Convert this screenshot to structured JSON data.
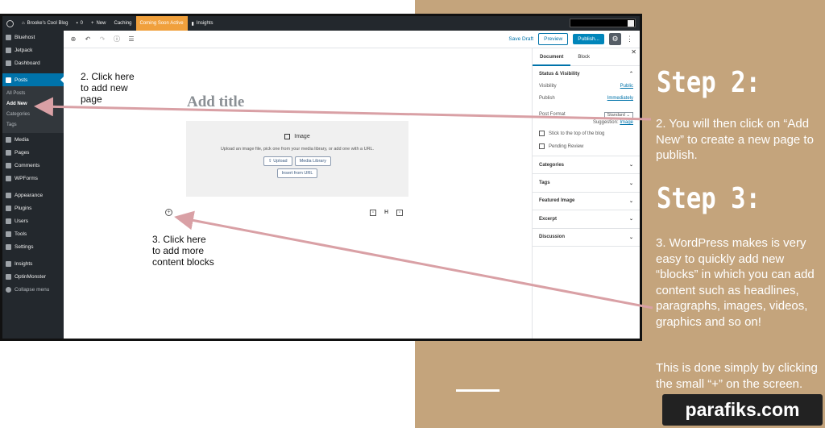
{
  "admin_bar": {
    "site": "Brooke's Cool Blog",
    "comments": "0",
    "new": "New",
    "caching": "Caching",
    "coming_soon": "Coming Soon Active",
    "insights": "Insights"
  },
  "sidebar": {
    "items_top": [
      {
        "label": "Bluehost",
        "icon": "bluehost-icon"
      },
      {
        "label": "Jetpack",
        "icon": "jetpack-icon"
      },
      {
        "label": "Dashboard",
        "icon": "dashboard-icon"
      }
    ],
    "posts": "Posts",
    "sub": [
      "All Posts",
      "Add New",
      "Categories",
      "Tags"
    ],
    "items_mid": [
      {
        "label": "Media",
        "icon": "media-icon"
      },
      {
        "label": "Pages",
        "icon": "pages-icon"
      },
      {
        "label": "Comments",
        "icon": "comments-icon"
      },
      {
        "label": "WPForms",
        "icon": "wpforms-icon"
      }
    ],
    "items_bottom": [
      {
        "label": "Appearance",
        "icon": "appearance-icon"
      },
      {
        "label": "Plugins",
        "icon": "plugins-icon"
      },
      {
        "label": "Users",
        "icon": "users-icon"
      },
      {
        "label": "Tools",
        "icon": "tools-icon"
      },
      {
        "label": "Settings",
        "icon": "settings-icon"
      }
    ],
    "items_end": [
      {
        "label": "Insights",
        "icon": "insights-icon"
      },
      {
        "label": "OptinMonster",
        "icon": "optinmonster-icon"
      },
      {
        "label": "Collapse menu",
        "icon": "collapse-icon"
      }
    ]
  },
  "toolbar": {
    "save_draft": "Save Draft",
    "preview": "Preview",
    "publish": "Publish..."
  },
  "editor": {
    "title_placeholder": "Add title",
    "image_label": "Image",
    "image_desc": "Upload an image file, pick one from your media library, or add one with a URL.",
    "upload": "Upload",
    "media_library": "Media Library",
    "insert_url": "Insert from URL",
    "insert_h": "H"
  },
  "settings": {
    "tab_document": "Document",
    "tab_block": "Block",
    "status_visibility": "Status & Visibility",
    "visibility": "Visibility",
    "visibility_val": "Public",
    "publish": "Publish",
    "publish_val": "Immediately",
    "post_format": "Post Format",
    "post_format_val": "Standard",
    "suggestion": "Suggestion:",
    "suggestion_val": "Image",
    "stick": "Stick to the top of the blog",
    "pending": "Pending Review",
    "panels": [
      "Categories",
      "Tags",
      "Featured Image",
      "Excerpt",
      "Discussion"
    ]
  },
  "callouts": {
    "c2": "2. Click here to add new page",
    "c3": "3. Click here to add more content blocks"
  },
  "steps": {
    "step2_title": "Step 2:",
    "step2_text": "2. You will then click on “Add New” to create a new page to publish.",
    "step3_title": "Step 3:",
    "step3_text": "3. WordPress makes is very easy to quickly add new “blocks” in which you can add content such as headlines, paragraphs, images, videos, graphics and so on!",
    "step3_extra": "This is done simply by clicking the small “+” on the screen."
  },
  "watermark": "parafiks.com",
  "colors": {
    "accent": "#0073aa",
    "tan": "#c4a47c",
    "arrow": "#d9a0a5"
  }
}
